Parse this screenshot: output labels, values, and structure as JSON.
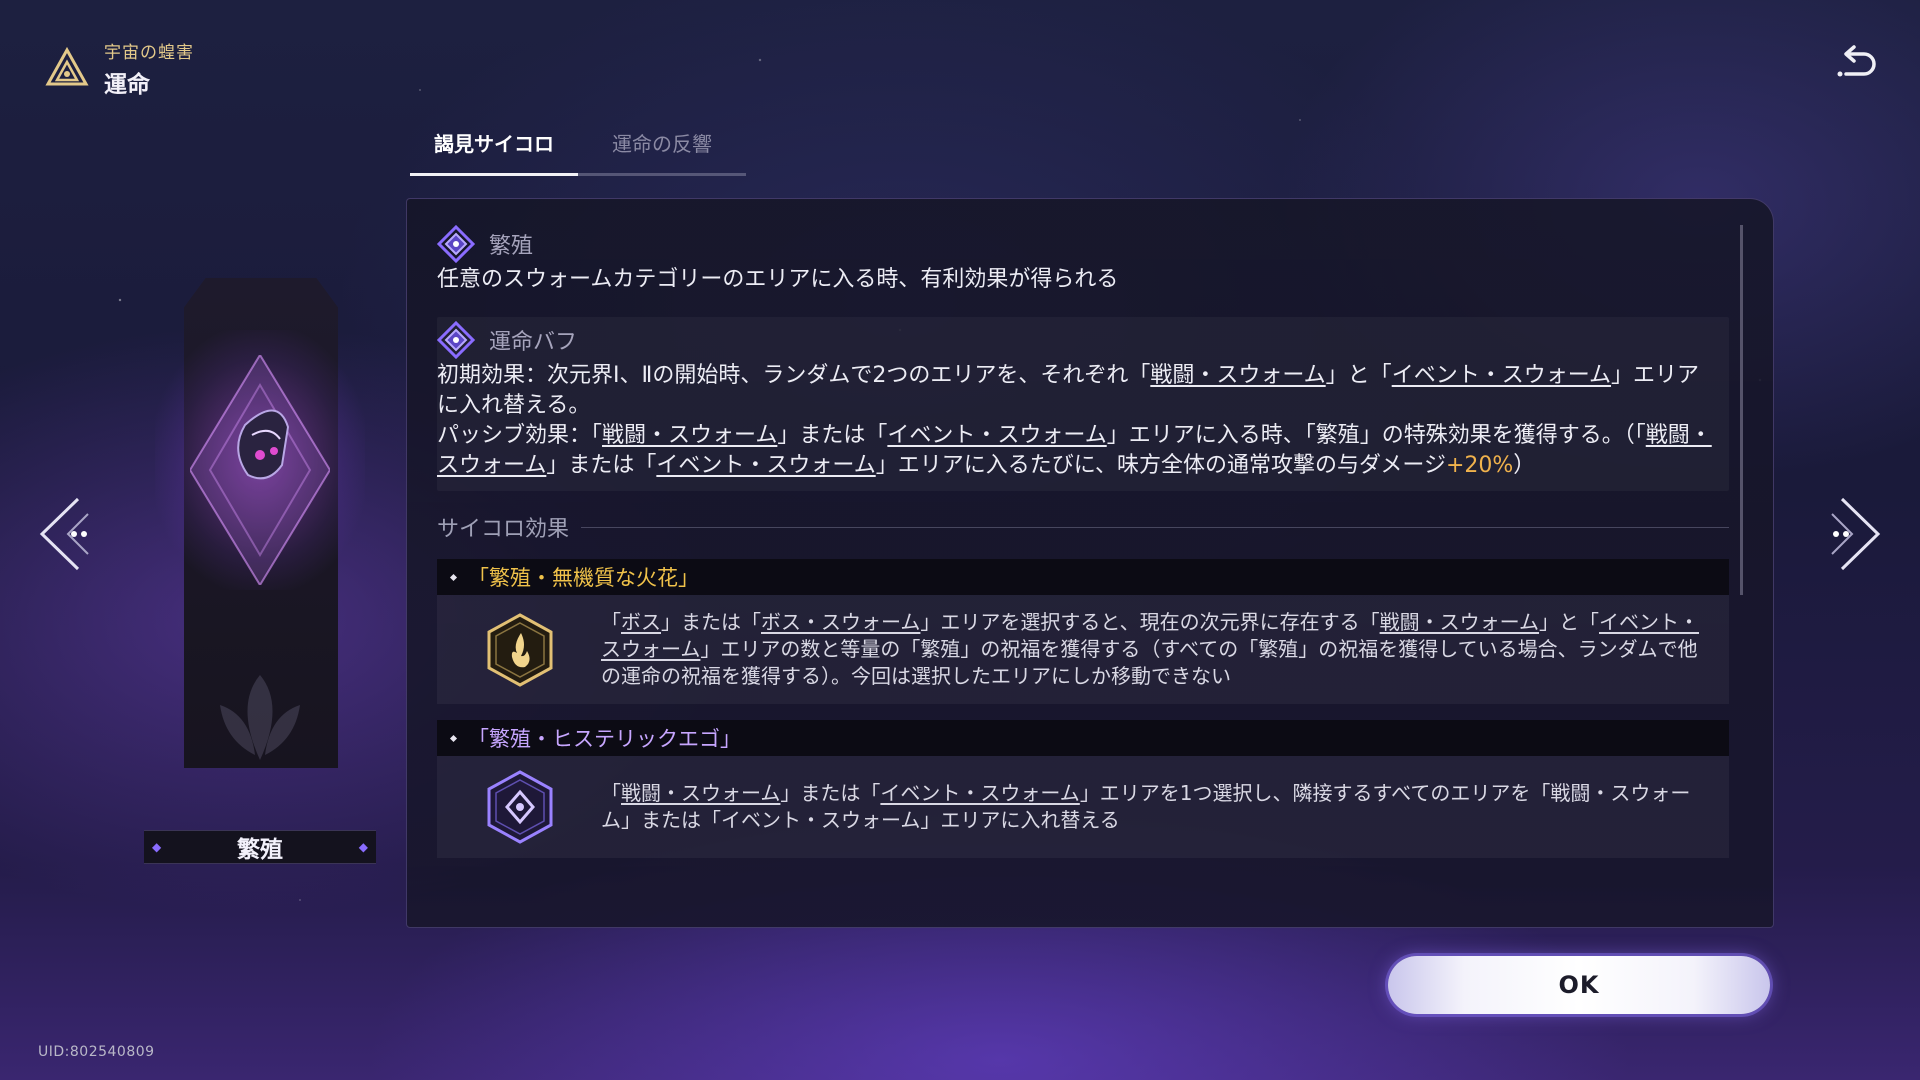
{
  "header": {
    "subtitle": "宇宙の蝗害",
    "title": "運命"
  },
  "tabs": [
    {
      "label": "謁見サイコロ",
      "active": true
    },
    {
      "label": "運命の反響",
      "active": false
    }
  ],
  "pillar": {
    "name": "繁殖"
  },
  "panel": {
    "path": {
      "title": "繁殖",
      "description": "任意のスウォームカテゴリーのエリアに入る時、有利効果が得られる"
    },
    "buff": {
      "title": "運命バフ",
      "line1_prefix": "初期効果：次元界Ⅰ、Ⅱの開始時、ランダムで2つのエリアを、それぞれ「",
      "line1_link1": "戦闘・スウォーム",
      "line1_mid": "」と「",
      "line1_link2": "イベント・スウォーム",
      "line1_suffix": "」エリアに入れ替える。",
      "line2_prefix": "パッシブ効果：「",
      "line2_link1": "戦闘・スウォーム",
      "line2_mid1": "」または「",
      "line2_link2": "イベント・スウォーム",
      "line2_mid2": "」エリアに入る時、「繁殖」の特殊効果を獲得する。（「",
      "line2_link3": "戦闘・スウォーム",
      "line2_mid3": "」または「",
      "line2_link4": "イベント・スウォーム",
      "line2_mid4": "」エリアに入るたびに、味方全体の通常攻撃の与ダメージ",
      "line2_highlight": "+20%",
      "line2_suffix": "）"
    },
    "dice_heading": "サイコロ効果",
    "effects": [
      {
        "name": "「繁殖・無機質な火花」",
        "t1": "「",
        "l1": "ボス",
        "t2": "」または「",
        "l2": "ボス・スウォーム",
        "t3": "」エリアを選択すると、現在の次元界に存在する「",
        "l3": "戦闘・スウォーム",
        "t4": "」と「",
        "l4": "イベント・スウォーム",
        "t5": "」エリアの数と等量の「繁殖」の祝福を獲得する（すべての「繁殖」の祝福を獲得している場合、ランダムで他の運命の祝福を獲得する）。今回は選択したエリアにしか移動できない"
      },
      {
        "name": "「繁殖・ヒステリックエゴ」",
        "t1": "「",
        "l1": "戦闘・スウォーム",
        "t2": "」または「",
        "l2": "イベント・スウォーム",
        "t3": "」エリアを1つ選択し、隣接するすべてのエリアを「戦闘・スウォーム」または「イベント・スウォーム」エリアに入れ替える"
      }
    ]
  },
  "ok_label": "OK",
  "uid": "UID:802540809",
  "colors": {
    "gold": "#f0c24a",
    "purple": "#c7a6ff",
    "highlight": "#f0b24c",
    "accent": "#8a6cff"
  },
  "icons": [
    "path-icon",
    "back-icon",
    "prev-arrow-icon",
    "next-arrow-icon",
    "flame-icon",
    "crest-icon",
    "propagation-emblem-icon"
  ]
}
